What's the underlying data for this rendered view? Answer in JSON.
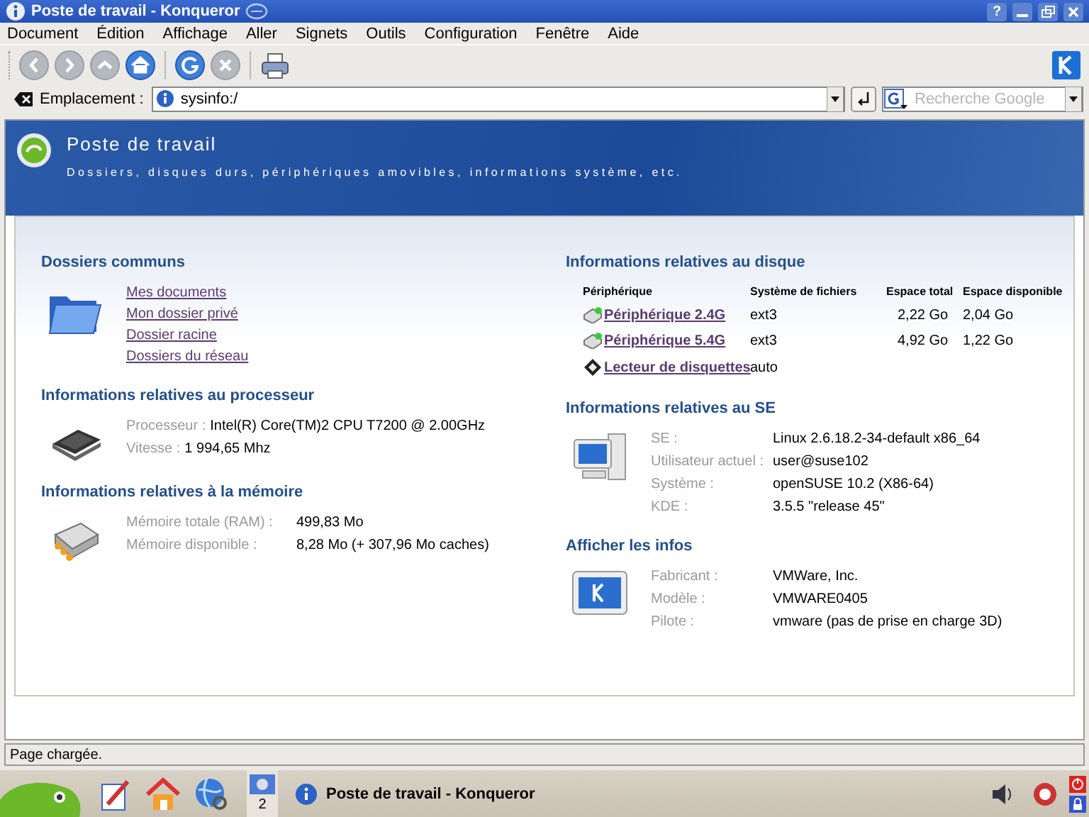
{
  "window": {
    "title": "Poste de travail - Konqueror",
    "buttons": [
      "?"
    ]
  },
  "menu": [
    {
      "label": "Document"
    },
    {
      "label": "Édition"
    },
    {
      "label": "Affichage"
    },
    {
      "label": "Aller"
    },
    {
      "label": "Signets"
    },
    {
      "label": "Outils"
    },
    {
      "label": "Configuration"
    },
    {
      "label": "Fenêtre"
    },
    {
      "label": "Aide"
    }
  ],
  "toolbar": [
    {
      "kind": "back",
      "disabled": true
    },
    {
      "kind": "forward",
      "disabled": true
    },
    {
      "kind": "up",
      "disabled": true
    },
    {
      "kind": "home",
      "disabled": false
    },
    {
      "kind": "sep"
    },
    {
      "kind": "reload",
      "disabled": false
    },
    {
      "kind": "stop",
      "disabled": true
    },
    {
      "kind": "sep"
    },
    {
      "kind": "print",
      "disabled": false
    }
  ],
  "location": {
    "label": "Emplacement :",
    "value": "sysinfo:/",
    "search_placeholder": "Recherche Google"
  },
  "page": {
    "title": "Poste de travail",
    "subtitle": "Dossiers, disques durs, périphériques amovibles, informations système, etc."
  },
  "left": [
    {
      "kind": "links",
      "title": "Dossiers communs",
      "links": [
        "Mes documents",
        "Mon dossier privé",
        "Dossier racine",
        "Dossiers du réseau"
      ]
    },
    {
      "kind": "info_inline",
      "title": "Informations relatives au processeur",
      "rows": [
        {
          "label": "Processeur :",
          "value": "Intel(R) Core(TM)2 CPU T7200 @ 2.00GHz"
        },
        {
          "label": "Vitesse :",
          "value": "1 994,65 Mhz"
        }
      ]
    },
    {
      "kind": "info",
      "title": "Informations relatives à la mémoire",
      "rows": [
        {
          "label": "Mémoire totale (RAM) :",
          "value": "499,83 Mo"
        },
        {
          "label": "Mémoire disponible :",
          "value": "8,28 Mo (+ 307,96 Mo caches)"
        }
      ]
    }
  ],
  "right": [
    {
      "kind": "table",
      "title": "Informations relatives au disque",
      "columns": [
        "Périphérique",
        "Système de fichiers",
        "Espace total",
        "Espace disponible"
      ],
      "rows": [
        {
          "kind": "hdd",
          "name": "Périphérique 2.4G",
          "fs": "ext3",
          "total": "2,22 Go",
          "free": "2,04 Go"
        },
        {
          "kind": "hdd",
          "name": "Périphérique 5.4G",
          "fs": "ext3",
          "total": "4,92 Go",
          "free": "1,22 Go"
        },
        {
          "kind": "floppy",
          "name": "Lecteur de disquettes",
          "fs": "auto"
        }
      ]
    },
    {
      "kind": "info",
      "title": "Informations relatives au SE",
      "rows": [
        {
          "label": "SE :",
          "value": "Linux 2.6.18.2-34-default x86_64"
        },
        {
          "label": "Utilisateur actuel :",
          "value": "user@suse102"
        },
        {
          "label": "Système :",
          "value": "openSUSE 10.2 (X86-64)"
        },
        {
          "label": "KDE :",
          "value": "3.5.5 \"release 45\""
        }
      ]
    },
    {
      "kind": "info",
      "title": "Afficher les infos",
      "rows": [
        {
          "label": "Fabricant :",
          "value": "VMWare, Inc."
        },
        {
          "label": "Modèle :",
          "value": "VMWARE0405"
        },
        {
          "label": "Pilote :",
          "value": "vmware (pas de prise en charge 3D)"
        }
      ]
    }
  ],
  "status_bar": "Page chargée.",
  "taskbar": {
    "desktop": "2",
    "task": "Poste de travail - Konqueror"
  }
}
